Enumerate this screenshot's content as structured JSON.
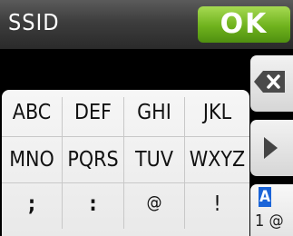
{
  "header": {
    "title": "SSID",
    "ok_label": "OK"
  },
  "keyboard": {
    "rows": [
      [
        "ABC",
        "DEF",
        "GHI",
        "JKL"
      ],
      [
        "MNO",
        "PQRS",
        "TUV",
        "WXYZ"
      ],
      [
        ";",
        ":",
        "@",
        "!"
      ]
    ]
  },
  "side": {
    "backspace_icon": "backspace-icon",
    "cursor_icon": "cursor-right-icon",
    "mode_top": "A",
    "mode_bottom": "1 @"
  },
  "colors": {
    "ok": "#6fb21d",
    "mode_accent": "#1a64d8"
  }
}
